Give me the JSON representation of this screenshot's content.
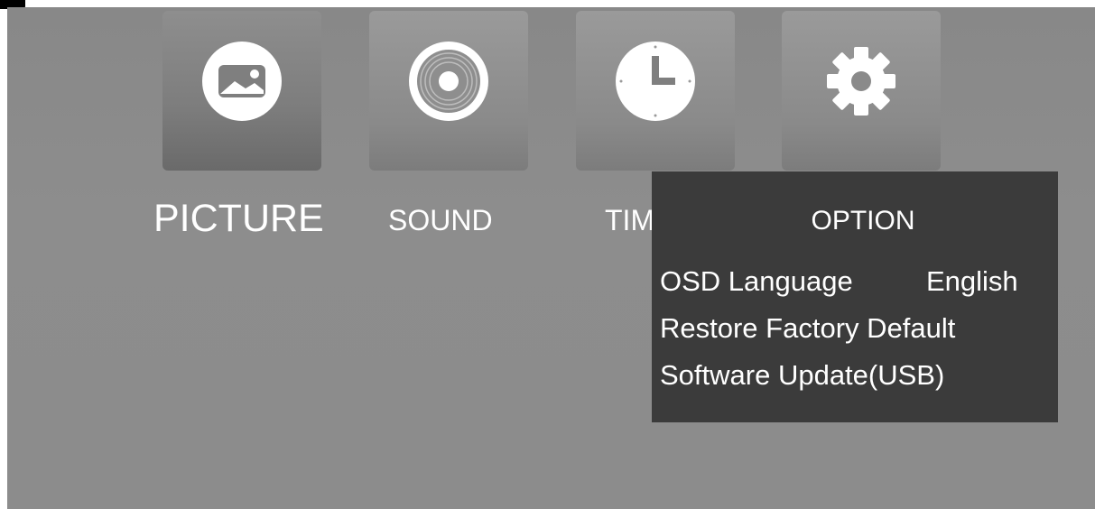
{
  "menu": {
    "tiles": [
      {
        "label": "PICTURE",
        "icon": "picture-icon"
      },
      {
        "label": "SOUND",
        "icon": "sound-icon"
      },
      {
        "label": "TIME",
        "icon": "clock-icon"
      },
      {
        "label": "OPTION",
        "icon": "gear-icon"
      }
    ]
  },
  "option_panel": {
    "title": "OPTION",
    "items": [
      {
        "label": "OSD Language",
        "value": "English"
      },
      {
        "label": "Restore Factory Default"
      },
      {
        "label": "Software Update(USB)"
      }
    ]
  },
  "colors": {
    "background": "#8c8c8c",
    "panel": "#3b3b3b",
    "text": "#ffffff"
  }
}
